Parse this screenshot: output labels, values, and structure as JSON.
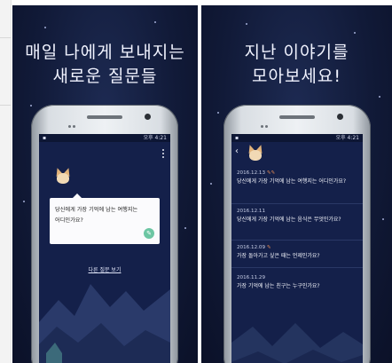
{
  "left": {
    "headline": [
      "매일 나에게 보내지는",
      "새로운 질문들"
    ],
    "status_time": "오후 4:21",
    "question": "당신에게 가장 기억에 남는 여행지는 어디인가요?",
    "other_question_link": "다른 질문 보기"
  },
  "right": {
    "headline": [
      "지난 이야기를",
      "모아보세요!"
    ],
    "status_time": "오후 4:21",
    "entries": [
      {
        "date": "2016.12.13",
        "text": "당신에게 가장 기억에 남는 여행지는 어디인가요?"
      },
      {
        "date": "2016.12.11",
        "text": "당신에게 가장 기억에 남는 음식은 무엇인가요?"
      },
      {
        "date": "2016.12.09",
        "text": "가장 돌아가고 싶은 때는 언제인가요?"
      },
      {
        "date": "2016.11.29",
        "text": "가장 기억에 남는 친구는 누구인가요?"
      }
    ]
  },
  "icons": {
    "pen": "pencil-icon",
    "back": "chevron-left-icon",
    "menu": "more-vertical-icon",
    "mascot": "fox-icon"
  },
  "colors": {
    "background": "#111a38",
    "card": "#fbfbfd",
    "accent": "#6cc6a3",
    "date_mark": "#e68c54"
  }
}
